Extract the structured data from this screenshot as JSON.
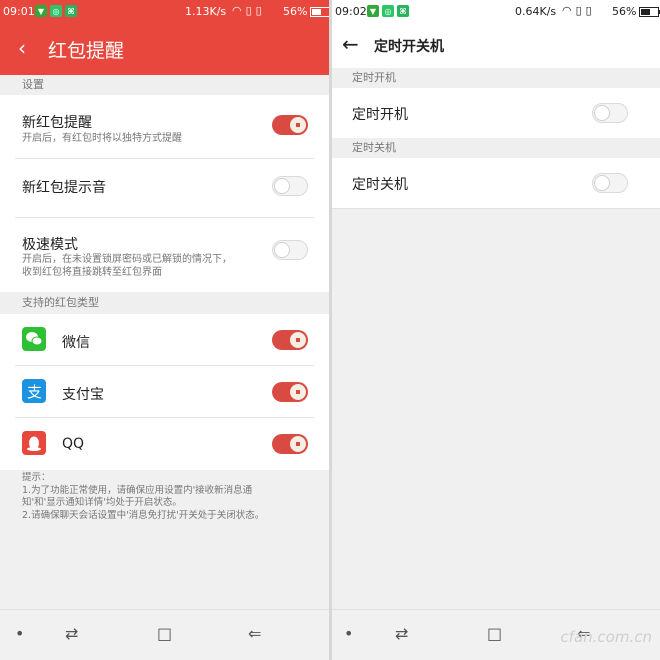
{
  "left": {
    "status": {
      "time": "09:01",
      "speed": "1.13K/s",
      "battery": "56%"
    },
    "header": {
      "title": "红包提醒"
    },
    "section_settings": "设置",
    "settings": [
      {
        "title": "新红包提醒",
        "subtitle": "开启后，有红包时将以独特方式提醒",
        "on": true
      },
      {
        "title": "新红包提示音",
        "subtitle": "",
        "on": false
      },
      {
        "title": "极速模式",
        "subtitle": "开启后，在未设置锁屏密码或已解锁的情况下，",
        "subtitle2": "收到红包将直接跳转至红包界面",
        "on": false
      }
    ],
    "section_types": "支持的红包类型",
    "types": [
      {
        "name": "微信",
        "icon": "wechat-icon",
        "on": true
      },
      {
        "name": "支付宝",
        "icon": "alipay-icon",
        "on": true
      },
      {
        "name": "QQ",
        "icon": "qq-icon",
        "on": true
      }
    ],
    "hint": {
      "l1": "提示：",
      "l2": "1.为了功能正常使用，请确保应用设置内'接收新消息通",
      "l3": "知'和'显示通知详情'均处于开启状态。",
      "l4": "2.请确保聊天会话设置中'消息免打扰'开关处于关闭状态。"
    }
  },
  "right": {
    "status": {
      "time": "09:02",
      "speed": "0.64K/s",
      "battery": "56%"
    },
    "header": {
      "title": "定时开关机"
    },
    "section_on": "定时开机",
    "row_on": {
      "title": "定时开机",
      "on": false
    },
    "section_off": "定时关机",
    "row_off": {
      "title": "定时关机",
      "on": false
    },
    "watermark": "cfan.com.cn"
  },
  "colors": {
    "accent": "#e8473d",
    "wechat": "#2dbf34",
    "alipay": "#1b93e0",
    "qq": "#e8473d"
  },
  "nav_icons": [
    "dot-icon",
    "switch-apps-icon",
    "home-square-icon",
    "back-icon"
  ]
}
